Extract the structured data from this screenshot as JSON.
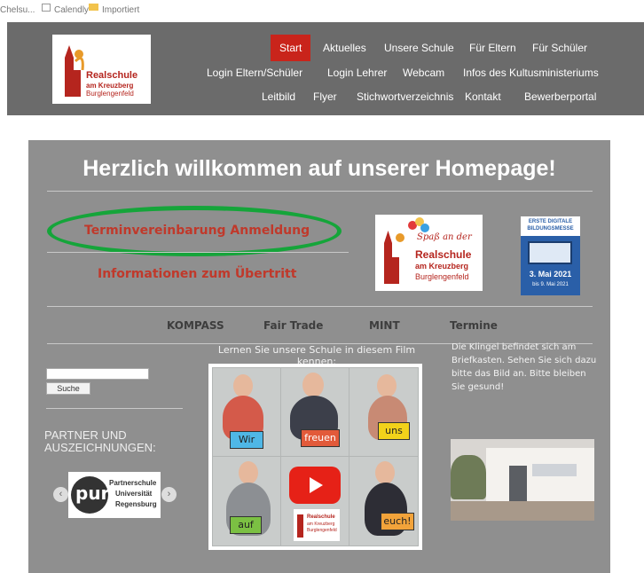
{
  "bookmarks": [
    {
      "label": "Chelsu...",
      "icon": "page-icon"
    },
    {
      "label": "Calendly",
      "icon": "calendar-icon"
    },
    {
      "label": "Importiert",
      "icon": "folder-icon"
    }
  ],
  "header": {
    "logo": {
      "line1": "Realschule",
      "line2": "am Kreuzberg",
      "line3": "Burglengenfeld"
    },
    "nav_row1": [
      "Start",
      "Aktuelles",
      "Unsere Schule",
      "Für Eltern",
      "Für Schüler"
    ],
    "nav_row2": [
      "Login Eltern/Schüler",
      "Login Lehrer",
      "Webcam",
      "Infos des Kultusministeriums"
    ],
    "nav_row3": [
      "Leitbild",
      "Flyer",
      "Stichwortverzeichnis",
      "Kontakt",
      "Bewerberportal"
    ],
    "active_color": "#c9241b",
    "bg_color": "#6b6b6b"
  },
  "main": {
    "welcome": "Herzlich willkommen auf unserer Homepage!",
    "termin_link": "Terminvereinbarung Anmeldung",
    "uebertritt_link": "Informationen zum Übertritt",
    "highlight_color": "#15a53a",
    "spass_badge": {
      "line1": "Spaß an der",
      "line2": "Realschule",
      "line3": "am Kreuzberg",
      "line4": "Burglengenfeld"
    },
    "messe_badge": {
      "title": "ERSTE DIGITALE BILDUNGSMESSE",
      "date1": "3. Mai 2021",
      "date2": "bis 9. Mai 2021"
    },
    "sub_nav": [
      "KOMPASS",
      "Fair Trade",
      "MINT",
      "Termine"
    ],
    "search_button": "Suche",
    "partner_heading": "PARTNER UND AUSZEICHNUNGEN:",
    "partner_logo": {
      "mark": "pur",
      "line1": "Partnerschule",
      "line2": "Universität",
      "line3": "Regensburg"
    },
    "film_caption": "Lernen Sie unsere Schule in diesem Film kennen:",
    "video_words": [
      "Wir",
      "freuen",
      "uns",
      "auf",
      "euch!"
    ],
    "video_logo": {
      "line1": "Realschule",
      "line2": "am Kreuzberg",
      "line3": "Burglengenfeld"
    },
    "right_text": "Die Klingel befindet sich am Briefkasten. Sehen Sie sich dazu bitte das Bild an. Bitte bleiben Sie gesund!"
  }
}
